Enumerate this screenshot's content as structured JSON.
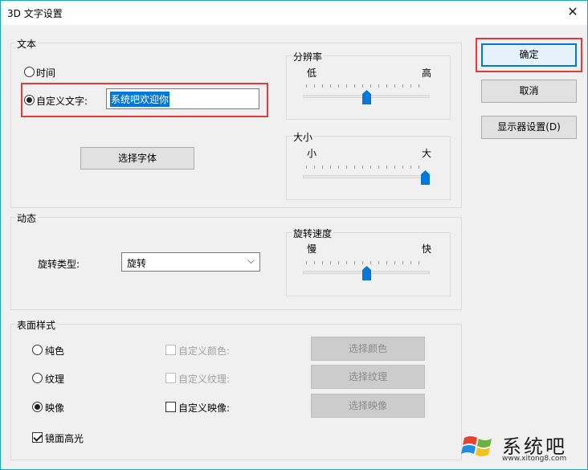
{
  "window": {
    "title": "3D 文字设置",
    "close_glyph": "✕"
  },
  "text_group": {
    "label": "文本",
    "time_label": "时间",
    "custom_text_label": "自定义文字:",
    "custom_text_value": "系统吧欢迎你",
    "choose_font": "选择字体"
  },
  "resolution": {
    "label": "分辨率",
    "low": "低",
    "high": "高",
    "level": 0.5
  },
  "size": {
    "label": "大小",
    "small": "小",
    "large": "大",
    "level": 1.0
  },
  "motion_group": {
    "label": "动态",
    "rotation_type_label": "旋转类型:",
    "rotation_type_value": "旋转"
  },
  "rotation_speed": {
    "label": "旋转速度",
    "slow": "慢",
    "fast": "快",
    "level": 0.5
  },
  "surface_group": {
    "label": "表面样式",
    "solid": "纯色",
    "texture": "纹理",
    "reflection": "映像",
    "custom_color": "自定义颜色:",
    "custom_texture": "自定义纹理:",
    "custom_reflection": "自定义映像:",
    "choose_color": "选择颜色",
    "choose_texture": "选择纹理",
    "choose_reflection": "选择映像",
    "specular": "镜面高光"
  },
  "buttons": {
    "ok": "确定",
    "cancel": "取消",
    "display_settings": "显示器设置(D)"
  },
  "watermark": {
    "text": "系统吧",
    "url": "www.xitong8.com"
  },
  "colors": {
    "accent": "#0078d7",
    "highlight_box": "#e03a3a"
  }
}
